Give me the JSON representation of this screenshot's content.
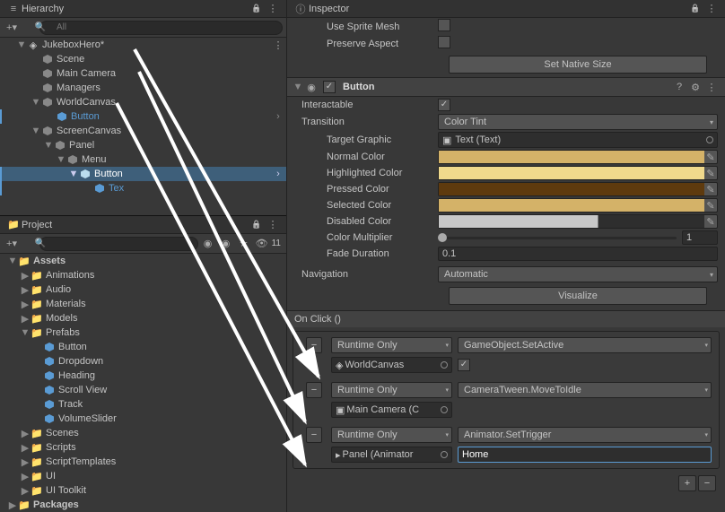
{
  "hierarchy": {
    "title": "Hierarchy",
    "search_placeholder": "All",
    "root": "JukeboxHero*",
    "nodes": {
      "scene": "Scene",
      "main_camera": "Main Camera",
      "managers": "Managers",
      "world_canvas": "WorldCanvas",
      "button1": "Button",
      "screen_canvas": "ScreenCanvas",
      "panel": "Panel",
      "menu": "Menu",
      "button2": "Button",
      "tex": "Tex"
    }
  },
  "project": {
    "title": "Project",
    "search_placeholder": "",
    "visible_count": "11",
    "assets": "Assets",
    "folders": {
      "animations": "Animations",
      "audio": "Audio",
      "materials": "Materials",
      "models": "Models",
      "prefabs": "Prefabs",
      "scenes": "Scenes",
      "scripts": "Scripts",
      "script_templates": "ScriptTemplates",
      "ui": "UI",
      "ui_toolkit": "UI Toolkit",
      "packages": "Packages"
    },
    "prefabs": {
      "button": "Button",
      "dropdown": "Dropdown",
      "heading": "Heading",
      "scroll_view": "Scroll View",
      "track": "Track",
      "volume_slider": "VolumeSlider"
    }
  },
  "inspector": {
    "title": "Inspector",
    "use_sprite_mesh": "Use Sprite Mesh",
    "preserve_aspect": "Preserve Aspect",
    "set_native_size": "Set Native Size",
    "component": "Button",
    "interactable": "Interactable",
    "transition": "Transition",
    "transition_value": "Color Tint",
    "target_graphic": "Target Graphic",
    "target_graphic_value": "Text (Text)",
    "normal_color": "Normal Color",
    "highlighted_color": "Highlighted Color",
    "pressed_color": "Pressed Color",
    "selected_color": "Selected Color",
    "disabled_color": "Disabled Color",
    "color_multiplier": "Color Multiplier",
    "color_multiplier_value": "1",
    "fade_duration": "Fade Duration",
    "fade_duration_value": "0.1",
    "navigation": "Navigation",
    "navigation_value": "Automatic",
    "visualize": "Visualize",
    "on_click": "On Click ()",
    "colors": {
      "normal": "#d4b268",
      "highlighted": "#f0d98c",
      "pressed": "#5e3a0e",
      "selected": "#d4b268",
      "disabled": "#c8c8c8"
    },
    "events": [
      {
        "mode": "Runtime Only",
        "func": "GameObject.SetActive",
        "target": "WorldCanvas",
        "arg_type": "checkbox",
        "arg_checked": true
      },
      {
        "mode": "Runtime Only",
        "func": "CameraTween.MoveToIdle",
        "target": "Main Camera (C",
        "arg_type": "none"
      },
      {
        "mode": "Runtime Only",
        "func": "Animator.SetTrigger",
        "target": "Panel (Animator",
        "arg_type": "text",
        "arg_value": "Home"
      }
    ]
  }
}
